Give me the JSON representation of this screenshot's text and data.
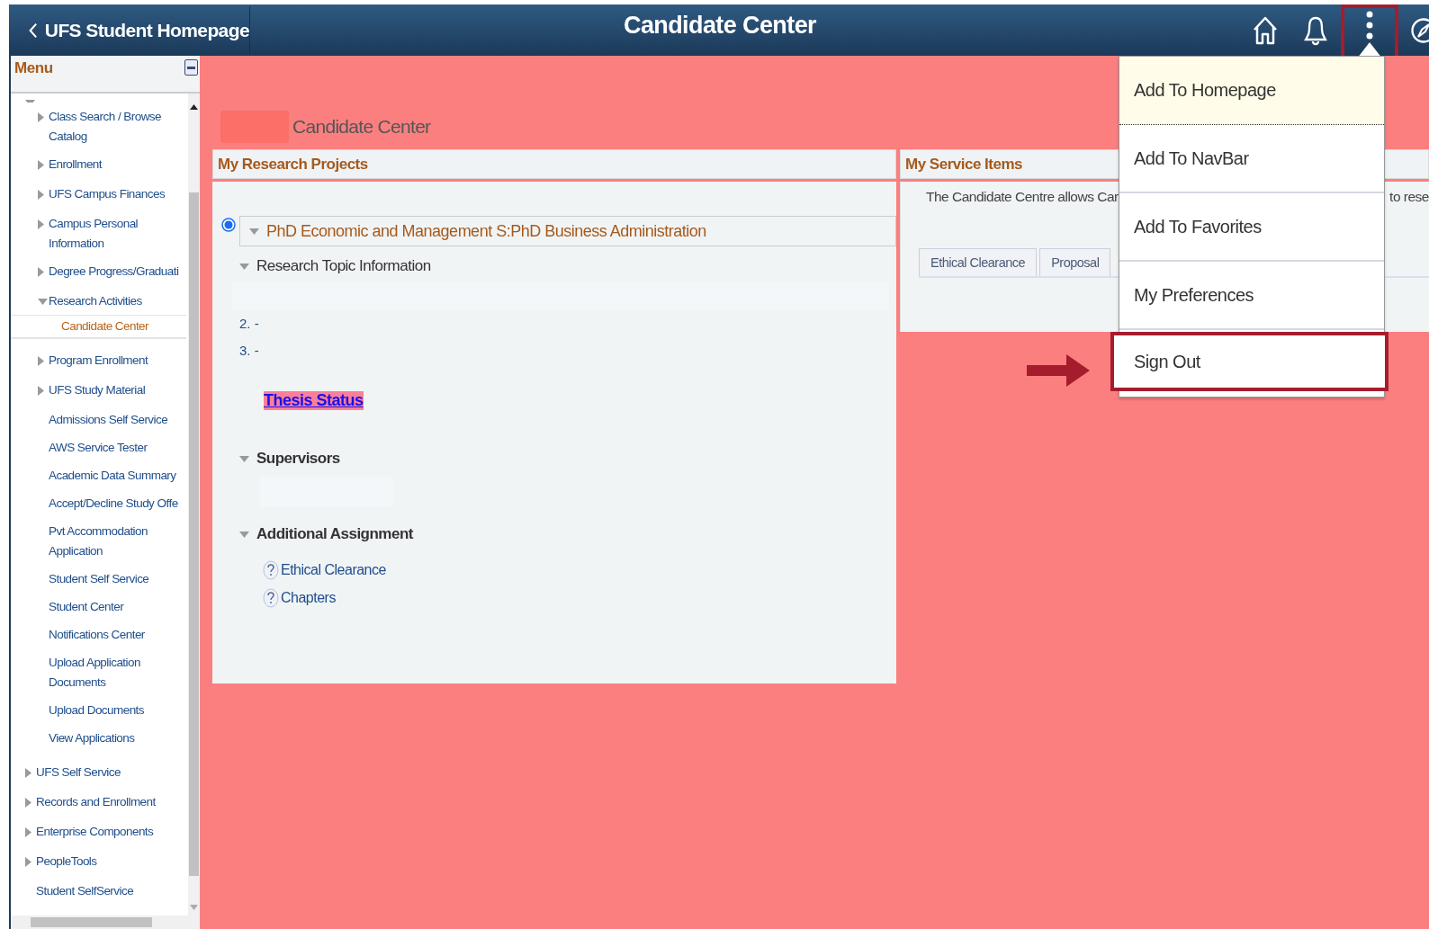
{
  "header": {
    "back_label": "UFS Student Homepage",
    "title": "Candidate Center",
    "actions": [
      {
        "kind": "home",
        "highlighted": false
      },
      {
        "kind": "bell",
        "highlighted": false
      },
      {
        "kind": "more",
        "highlighted": true
      },
      {
        "kind": "compass",
        "highlighted": false
      }
    ]
  },
  "sidebar": {
    "title": "Menu",
    "tree": [
      {
        "expanded": true,
        "children": [
          {
            "kind": "folder",
            "label": "Class Search / Browse Catalog",
            "expanded": false,
            "selected": false
          },
          {
            "kind": "folder",
            "label": "Enrollment",
            "expanded": false,
            "selected": false
          },
          {
            "kind": "folder",
            "label": "UFS Campus Finances",
            "expanded": false,
            "selected": false
          },
          {
            "kind": "folder",
            "label": "Campus Personal Information",
            "expanded": false,
            "selected": false
          },
          {
            "kind": "folder",
            "label": "Degree Progress/Graduati",
            "expanded": false,
            "selected": false
          },
          {
            "kind": "folder",
            "label": "Research Activities",
            "expanded": true,
            "selected": false,
            "children": [
              {
                "kind": "link",
                "label": "Candidate Center",
                "selected": true
              }
            ]
          },
          {
            "kind": "folder",
            "label": "Program Enrollment",
            "expanded": false,
            "selected": false
          },
          {
            "kind": "folder",
            "label": "UFS Study Material",
            "expanded": false,
            "selected": false
          },
          {
            "kind": "link",
            "label": "Admissions Self Service",
            "selected": false
          },
          {
            "kind": "link",
            "label": "AWS Service Tester",
            "selected": false
          },
          {
            "kind": "link",
            "label": "Academic Data Summary",
            "selected": false
          },
          {
            "kind": "link",
            "label": "Accept/Decline Study Offe",
            "selected": false
          },
          {
            "kind": "link",
            "label": "Pvt Accommodation Application",
            "selected": false
          },
          {
            "kind": "link",
            "label": "Student Self Service",
            "selected": false
          },
          {
            "kind": "link",
            "label": "Student Center",
            "selected": false
          },
          {
            "kind": "link",
            "label": "Notifications Center",
            "selected": false
          },
          {
            "kind": "link",
            "label": "Upload Application Documents",
            "selected": false
          },
          {
            "kind": "link",
            "label": "Upload Documents",
            "selected": false
          },
          {
            "kind": "link",
            "label": "View Applications",
            "selected": false
          }
        ]
      },
      {
        "kind": "folder",
        "label": "UFS Self Service",
        "expanded": false,
        "selected": false
      },
      {
        "kind": "folder",
        "label": "Records and Enrollment",
        "expanded": false,
        "selected": false
      },
      {
        "kind": "folder",
        "label": "Enterprise Components",
        "expanded": false,
        "selected": false
      },
      {
        "kind": "folder",
        "label": "PeopleTools",
        "expanded": false,
        "selected": false
      },
      {
        "kind": "link",
        "label": "Student SelfService",
        "selected": false
      }
    ]
  },
  "page_title": "Candidate Center",
  "research": {
    "title": "My Research Projects",
    "project": {
      "selected": true,
      "expanded": true,
      "title": "PhD Economic and Management S:PhD Business Administration"
    },
    "topic": {
      "title": "Research Topic Information",
      "expanded": true,
      "lines": [
        "2. -",
        "3. -"
      ]
    },
    "link": "Thesis Status",
    "supervisors": {
      "title": "Supervisors",
      "expanded": true
    },
    "assignment": {
      "title": "Additional Assignment",
      "expanded": true,
      "items": [
        "Ethical Clearance",
        "Chapters"
      ]
    }
  },
  "service": {
    "title": "My Service Items",
    "description_start": "The Candidate Centre allows Car",
    "description_end": "to rese",
    "tabs": [
      {
        "label": "Ethical Clearance",
        "selected": false
      },
      {
        "label": "Proposal",
        "selected": false
      }
    ]
  },
  "actions_menu": {
    "items": [
      {
        "label": "Add To Homepage",
        "hovered": true,
        "highlighted": false
      },
      {
        "label": "Add To NavBar",
        "hovered": false,
        "highlighted": false
      },
      {
        "label": "Add To Favorites",
        "hovered": false,
        "highlighted": false
      },
      {
        "label": "My Preferences",
        "hovered": false,
        "highlighted": false
      },
      {
        "label": "Sign Out",
        "hovered": false,
        "highlighted": true
      }
    ]
  }
}
